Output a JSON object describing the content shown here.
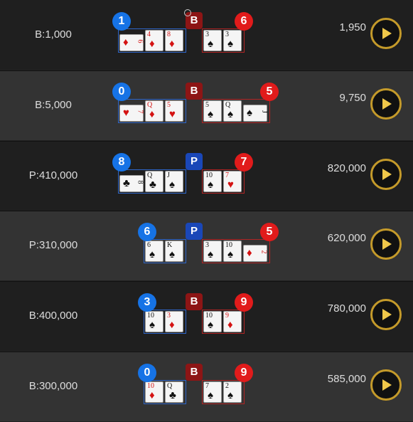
{
  "rows": [
    {
      "bet": "B:1,000",
      "payout": "1,950",
      "winner": "B",
      "player_score": "1",
      "banker_score": "6",
      "player_cards": [
        {
          "rank": "6",
          "suit": "♦",
          "color": "red",
          "side": true
        },
        {
          "rank": "4",
          "suit": "♦",
          "color": "red"
        },
        {
          "rank": "8",
          "suit": "♦",
          "color": "red"
        }
      ],
      "banker_cards": [
        {
          "rank": "3",
          "suit": "♠",
          "color": "black"
        },
        {
          "rank": "3",
          "suit": "♠",
          "color": "black"
        }
      ]
    },
    {
      "bet": "B:5,000",
      "payout": "9,750",
      "winner": "B",
      "player_score": "0",
      "banker_score": "5",
      "player_cards": [
        {
          "rank": "7",
          "suit": "♥",
          "color": "red",
          "side": true
        },
        {
          "rank": "Q",
          "suit": "♦",
          "color": "red"
        },
        {
          "rank": "5",
          "suit": "♥",
          "color": "red"
        }
      ],
      "banker_cards": [
        {
          "rank": "5",
          "suit": "♠",
          "color": "black"
        },
        {
          "rank": "Q",
          "suit": "♠",
          "color": "black"
        },
        {
          "rank": "J",
          "suit": "♠",
          "color": "black",
          "side": true
        }
      ]
    },
    {
      "bet": "P:410,000",
      "payout": "820,000",
      "winner": "P",
      "player_score": "8",
      "banker_score": "7",
      "player_cards": [
        {
          "rank": "8",
          "suit": "♣",
          "color": "black",
          "side": true
        },
        {
          "rank": "Q",
          "suit": "♣",
          "color": "black"
        },
        {
          "rank": "J",
          "suit": "♠",
          "color": "black"
        }
      ],
      "banker_cards": [
        {
          "rank": "10",
          "suit": "♠",
          "color": "black"
        },
        {
          "rank": "7",
          "suit": "♥",
          "color": "red"
        }
      ]
    },
    {
      "bet": "P:310,000",
      "payout": "620,000",
      "winner": "P",
      "player_score": "6",
      "banker_score": "5",
      "player_cards": [
        {
          "rank": "6",
          "suit": "♠",
          "color": "black"
        },
        {
          "rank": "K",
          "suit": "♠",
          "color": "black"
        }
      ],
      "banker_cards": [
        {
          "rank": "3",
          "suit": "♠",
          "color": "black"
        },
        {
          "rank": "10",
          "suit": "♠",
          "color": "black"
        },
        {
          "rank": "2",
          "suit": "♦",
          "color": "red",
          "side": true
        }
      ]
    },
    {
      "bet": "B:400,000",
      "payout": "780,000",
      "winner": "B",
      "player_score": "3",
      "banker_score": "9",
      "player_cards": [
        {
          "rank": "10",
          "suit": "♠",
          "color": "black"
        },
        {
          "rank": "3",
          "suit": "♦",
          "color": "red"
        }
      ],
      "banker_cards": [
        {
          "rank": "10",
          "suit": "♠",
          "color": "black"
        },
        {
          "rank": "9",
          "suit": "♦",
          "color": "red"
        }
      ]
    },
    {
      "bet": "B:300,000",
      "payout": "585,000",
      "winner": "B",
      "player_score": "0",
      "banker_score": "9",
      "player_cards": [
        {
          "rank": "10",
          "suit": "♦",
          "color": "red"
        },
        {
          "rank": "Q",
          "suit": "♣",
          "color": "black"
        }
      ],
      "banker_cards": [
        {
          "rank": "7",
          "suit": "♠",
          "color": "black"
        },
        {
          "rank": "2",
          "suit": "♠",
          "color": "black"
        }
      ]
    }
  ],
  "icons": {
    "play": "play-icon",
    "ring": "ring-icon"
  },
  "colors": {
    "player": "#1673e6",
    "banker": "#e11b1b",
    "play_ring": "#c49a2a"
  }
}
